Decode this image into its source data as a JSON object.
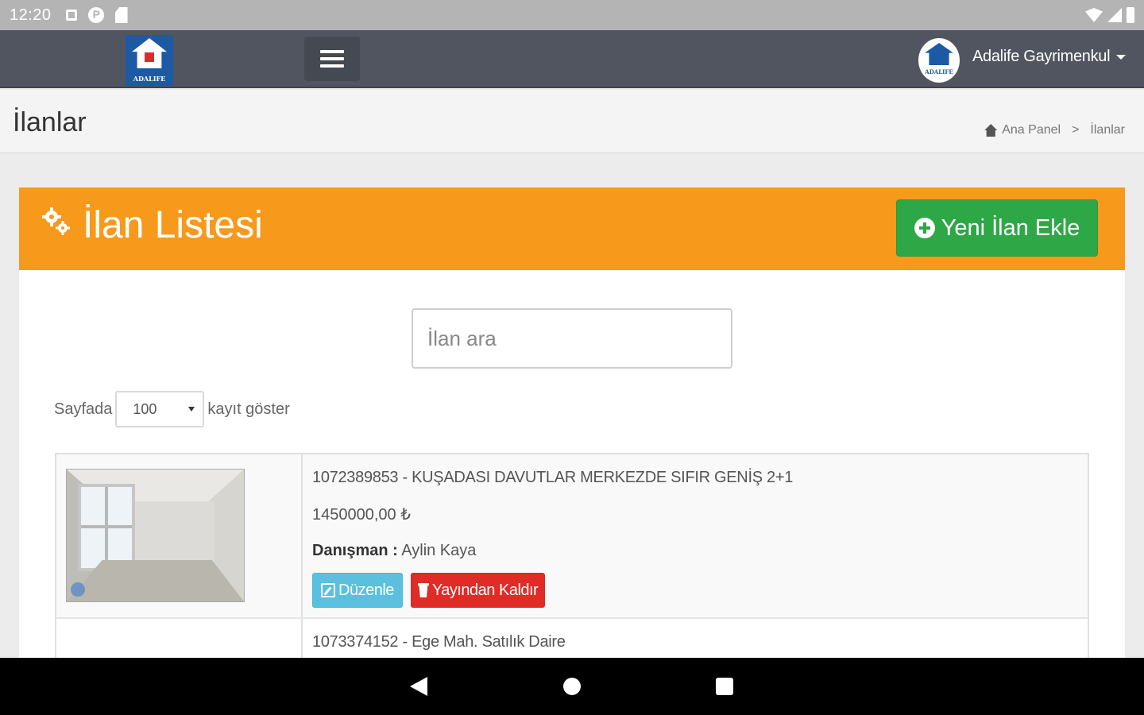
{
  "status_bar": {
    "time": "12:20"
  },
  "top_nav": {
    "logo_text": "ADALIFE",
    "avatar_text": "ADALIFE",
    "user_name": "Adalife Gayrimenkul"
  },
  "page_header": {
    "title": "İlanlar",
    "breadcrumb": [
      "Ana Panel",
      "İlanlar"
    ]
  },
  "panel": {
    "title": "İlan Listesi",
    "new_button_label": "Yeni İlan Ekle",
    "accent_color": "#f7991b",
    "new_button_color": "#2ea747"
  },
  "search": {
    "placeholder": "İlan ara",
    "value": ""
  },
  "page_length": {
    "prefix": "Sayfada",
    "selected": "100",
    "suffix": "kayıt göster"
  },
  "listings": [
    {
      "title": "1072389853 - KUŞADASI DAVUTLAR MERKEZDE SIFIR GENİŞ 2+1",
      "price": "1450000,00 ₺",
      "advisor_label": "Danışman :",
      "advisor_name": "Aylin Kaya",
      "edit_label": "Düzenle",
      "remove_label": "Yayından Kaldır"
    },
    {
      "title": "1073374152 - Ege Mah. Satılık Daire"
    }
  ]
}
